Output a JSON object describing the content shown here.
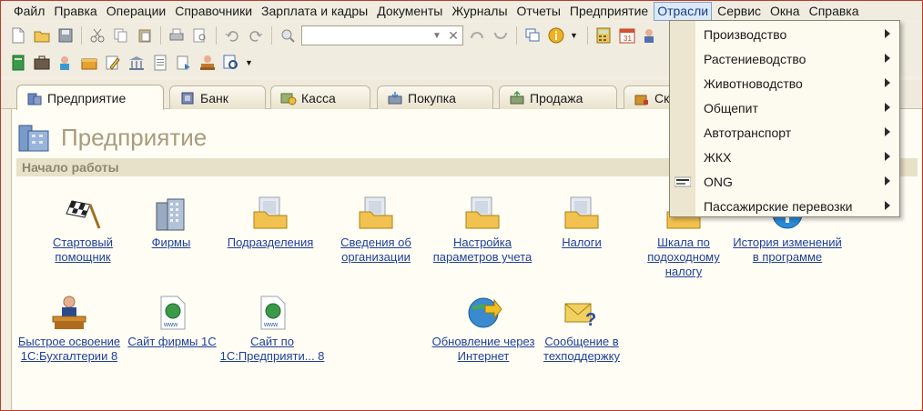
{
  "menubar": {
    "items": [
      {
        "label": "Файл"
      },
      {
        "label": "Правка"
      },
      {
        "label": "Операции"
      },
      {
        "label": "Справочники"
      },
      {
        "label": "Зарплата и кадры"
      },
      {
        "label": "Документы"
      },
      {
        "label": "Журналы"
      },
      {
        "label": "Отчеты"
      },
      {
        "label": "Предприятие"
      },
      {
        "label": "Отрасли"
      },
      {
        "label": "Сервис"
      },
      {
        "label": "Окна"
      },
      {
        "label": "Справка"
      }
    ]
  },
  "toolbar": {
    "search_value": ""
  },
  "tabs": [
    {
      "label": "Предприятие"
    },
    {
      "label": "Банк"
    },
    {
      "label": "Касса"
    },
    {
      "label": "Покупка"
    },
    {
      "label": "Продажа"
    },
    {
      "label": "Скл"
    }
  ],
  "page": {
    "title": "Предприятие",
    "section": "Начало работы"
  },
  "tiles": [
    {
      "label": "Стартовый помощник",
      "icon": "checkered-flag-icon"
    },
    {
      "label": "Фирмы",
      "icon": "buildings-icon"
    },
    {
      "label": "Подразделения",
      "icon": "folder-icon"
    },
    {
      "label": "Сведения об организации",
      "icon": "folder-icon"
    },
    {
      "label": "Настройка параметров учета",
      "icon": "folder-icon"
    },
    {
      "label": "Налоги",
      "icon": "folder-icon"
    },
    {
      "label": "Шкала по подоходному налогу",
      "icon": "folder-icon"
    },
    {
      "label": "История изменений в программе",
      "icon": "info-icon"
    },
    {
      "label": "Быстрое освоение 1С:Бухгалтерии 8",
      "icon": "teacher-icon"
    },
    {
      "label": "Сайт фирмы 1С",
      "icon": "web-page-icon"
    },
    {
      "label": "Сайт по 1С:Предприяти... 8",
      "icon": "web-page-icon"
    },
    {
      "label": "Обновление через Интернет",
      "icon": "globe-update-icon"
    },
    {
      "label": "Сообщение в техподдержку",
      "icon": "envelope-question-icon"
    }
  ],
  "dropdown": {
    "items": [
      {
        "label": "Производство"
      },
      {
        "label": "Растениеводство"
      },
      {
        "label": "Животноводство"
      },
      {
        "label": "Общепит"
      },
      {
        "label": "Автотранспорт"
      },
      {
        "label": "ЖКХ"
      },
      {
        "label": "ONG"
      },
      {
        "label": "Пассажирские перевозки"
      }
    ]
  },
  "colors": {
    "link": "#1f3f9a",
    "menu_active_bg": "#dbe8f6",
    "title": "#a89c7e",
    "section_bg": "#e8e1c9"
  }
}
